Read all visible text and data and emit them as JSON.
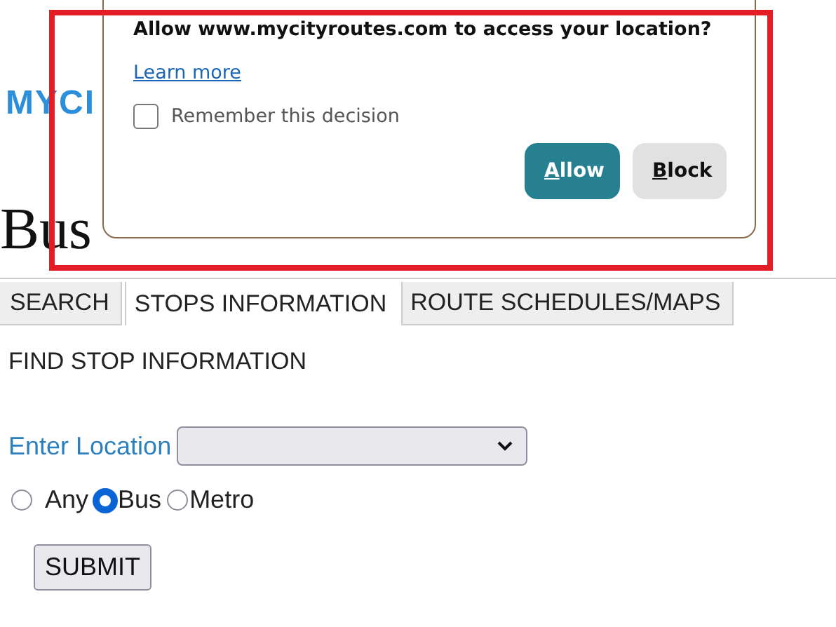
{
  "logo": "MYCI",
  "heading": "Bus",
  "tabs": [
    {
      "label": "SEARCH",
      "selected": false
    },
    {
      "label": "STOPS INFORMATION",
      "selected": true
    },
    {
      "label": "ROUTE SCHEDULES/MAPS",
      "selected": false
    }
  ],
  "section_title": "FIND STOP INFORMATION",
  "location": {
    "label": "Enter Location"
  },
  "transport_options": [
    {
      "label": "Any",
      "selected": false
    },
    {
      "label": "Bus",
      "selected": true
    },
    {
      "label": "Metro",
      "selected": false
    }
  ],
  "submit": "SUBMIT",
  "permission_prompt": {
    "message": "Allow www.mycityroutes.com to access your location?",
    "link": "Learn more",
    "remember": {
      "label": "Remember this decision",
      "checked": false
    },
    "buttons": [
      {
        "label": "Allow",
        "kind": "primary"
      },
      {
        "label": "Block",
        "kind": "secondary"
      }
    ]
  }
}
